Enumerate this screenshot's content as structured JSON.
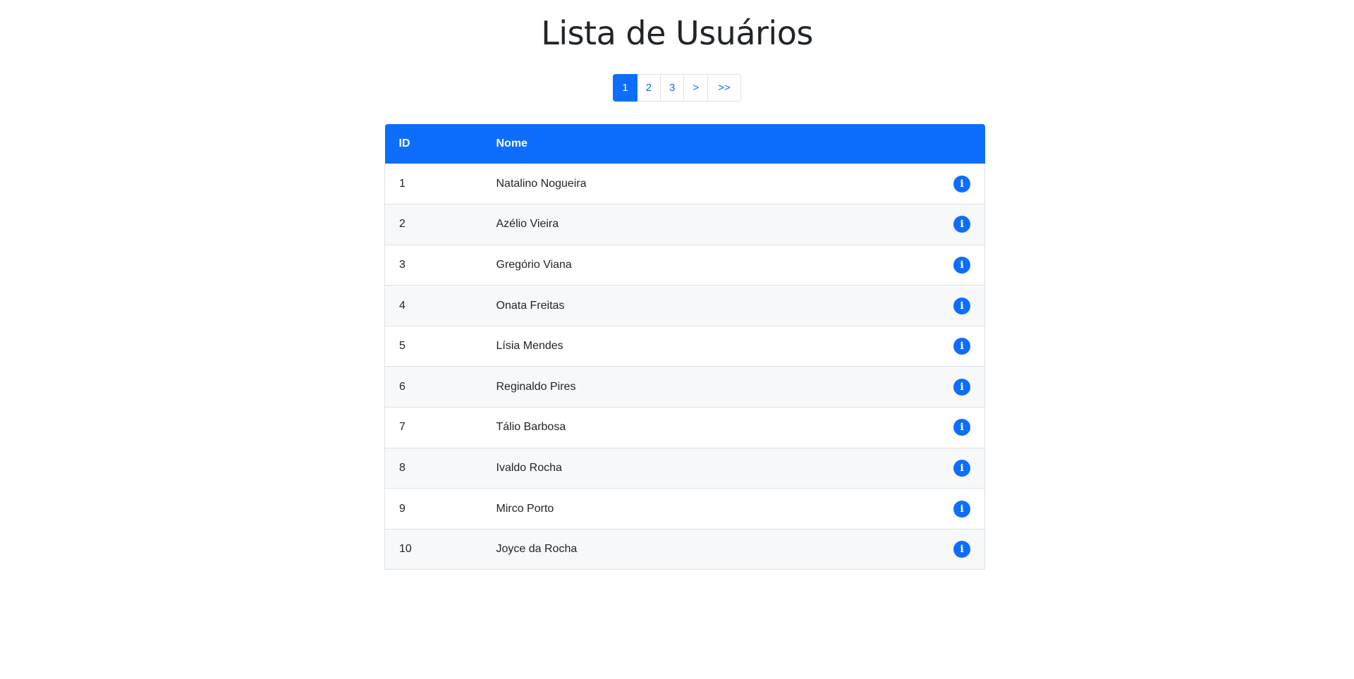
{
  "page": {
    "title": "Lista de Usuários"
  },
  "pagination": {
    "active": "1",
    "items": [
      {
        "label": "1",
        "active": true
      },
      {
        "label": "2",
        "active": false
      },
      {
        "label": "3",
        "active": false
      },
      {
        "label": ">",
        "active": false
      },
      {
        "label": ">>",
        "active": false
      }
    ]
  },
  "table": {
    "headers": [
      "ID",
      "Nome",
      ""
    ],
    "rows": [
      {
        "id": "1",
        "name": "Natalino Nogueira",
        "icon": "info-icon"
      },
      {
        "id": "2",
        "name": "Azélio Vieira",
        "icon": "info-icon"
      },
      {
        "id": "3",
        "name": "Gregório Viana",
        "icon": "info-icon"
      },
      {
        "id": "4",
        "name": "Onata Freitas",
        "icon": "info-icon"
      },
      {
        "id": "5",
        "name": "Lísia Mendes",
        "icon": "info-icon"
      },
      {
        "id": "6",
        "name": "Reginaldo Pires",
        "icon": "info-icon"
      },
      {
        "id": "7",
        "name": "Tálio Barbosa",
        "icon": "info-icon"
      },
      {
        "id": "8",
        "name": "Ivaldo Rocha",
        "icon": "info-icon"
      },
      {
        "id": "9",
        "name": "Mirco Porto",
        "icon": "info-icon"
      },
      {
        "id": "10",
        "name": "Joyce da Rocha",
        "icon": "info-icon"
      }
    ]
  },
  "colors": {
    "primary": "#0d6efd",
    "text": "#212529",
    "border": "#dee2e6",
    "stripe": "#f7f8fa"
  }
}
